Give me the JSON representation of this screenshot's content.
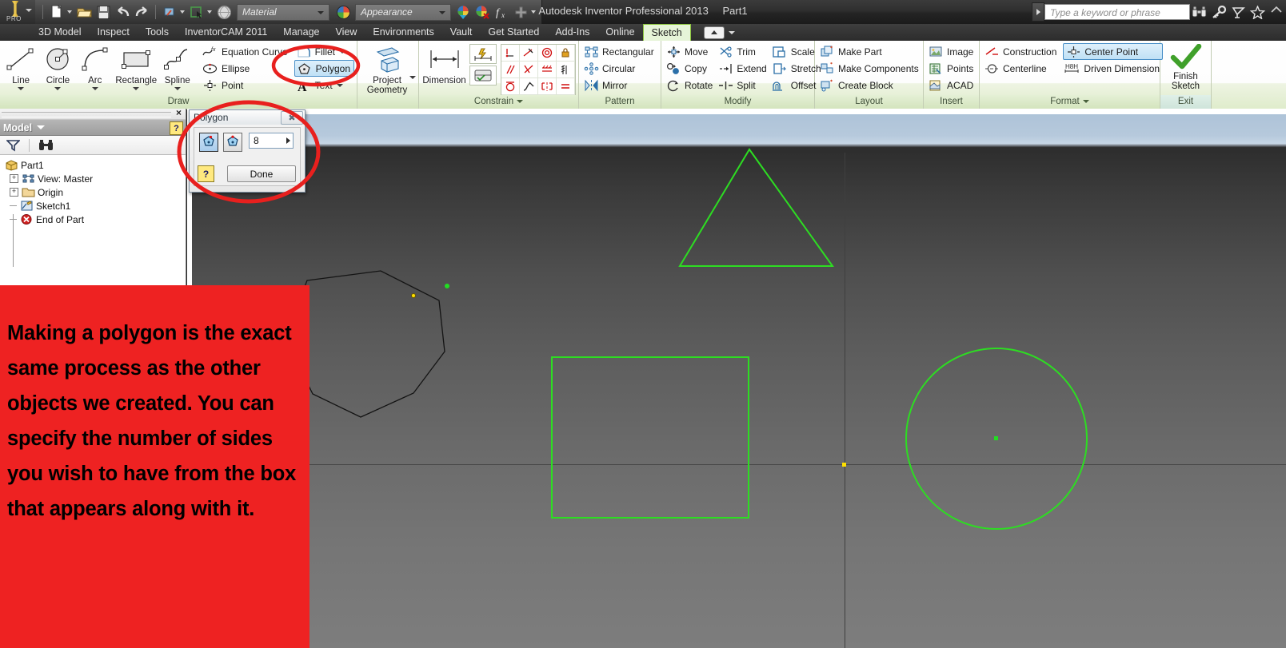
{
  "titlebar": {
    "app_title": "Autodesk Inventor Professional 2013",
    "document_name": "Part1",
    "logo_text": "PRO",
    "material_value": "Material",
    "appearance_value": "Appearance",
    "search_placeholder": "Type a keyword or phrase",
    "quick_access_icons": [
      "new-file-icon",
      "open-folder-icon",
      "save-icon",
      "undo-icon",
      "redo-icon",
      "update-icon",
      "select-icon",
      "material-sphere-icon"
    ],
    "help_icons": [
      "binoculars-icon",
      "key-icon",
      "satellite-icon",
      "star-icon"
    ]
  },
  "tabs": {
    "items": [
      "3D Model",
      "Inspect",
      "Tools",
      "InventorCAM 2011",
      "Manage",
      "View",
      "Environments",
      "Vault",
      "Get Started",
      "Add-Ins",
      "Online",
      "Sketch"
    ],
    "active": "Sketch"
  },
  "ribbon": {
    "panels": [
      {
        "title": "Draw",
        "has_dropdown": false,
        "big_buttons": [
          {
            "label": "Line",
            "icon": "line-tool-icon",
            "dropdown": true
          },
          {
            "label": "Circle",
            "icon": "circle-tool-icon",
            "dropdown": true
          },
          {
            "label": "Arc",
            "icon": "arc-tool-icon",
            "dropdown": true
          },
          {
            "label": "Rectangle",
            "icon": "rectangle-tool-icon",
            "dropdown": true
          },
          {
            "label": "Spline",
            "icon": "spline-tool-icon",
            "dropdown": true
          }
        ],
        "small_col_a": [
          {
            "label": "Equation Curve",
            "icon": "equation-curve-icon"
          },
          {
            "label": "Ellipse",
            "icon": "ellipse-icon"
          },
          {
            "label": "Point",
            "icon": "point-icon"
          }
        ],
        "small_col_b": [
          {
            "label": "Fillet",
            "icon": "fillet-icon",
            "dropdown": true,
            "selected": false
          },
          {
            "label": "Polygon",
            "icon": "polygon-icon",
            "dropdown": false,
            "selected": true
          },
          {
            "label": "Text",
            "icon": "text-icon",
            "dropdown": true,
            "selected": false
          }
        ]
      },
      {
        "title": "",
        "big_buttons": [
          {
            "label": "Project\nGeometry",
            "icon": "project-geometry-icon",
            "dropdown": true
          }
        ]
      },
      {
        "title": "Constrain",
        "has_dropdown": true,
        "big_buttons": [
          {
            "label": "Dimension",
            "icon": "dimension-icon",
            "dropdown": false
          }
        ],
        "stack_icons": [
          "auto-dimension-icon",
          "show-constraints-icon"
        ],
        "grid_icons": [
          "coincident-icon",
          "collinear-icon",
          "concentric-icon",
          "fix-icon",
          "parallel-icon",
          "perpendicular-icon",
          "horizontal-icon",
          "vertical-icon",
          "tangent-icon",
          "smooth-icon",
          "symmetric-icon",
          "equal-icon"
        ]
      },
      {
        "title": "Pattern",
        "small_col_a": [
          {
            "label": "Rectangular",
            "icon": "rectangular-pattern-icon"
          },
          {
            "label": "Circular",
            "icon": "circular-pattern-icon"
          },
          {
            "label": "Mirror",
            "icon": "mirror-icon"
          }
        ]
      },
      {
        "title": "Modify",
        "small_col_a": [
          {
            "label": "Move",
            "icon": "move-icon"
          },
          {
            "label": "Copy",
            "icon": "copy-icon"
          },
          {
            "label": "Rotate",
            "icon": "rotate-icon"
          }
        ],
        "small_col_b": [
          {
            "label": "Trim",
            "icon": "trim-icon"
          },
          {
            "label": "Extend",
            "icon": "extend-icon"
          },
          {
            "label": "Split",
            "icon": "split-icon"
          }
        ],
        "small_col_c": [
          {
            "label": "Scale",
            "icon": "scale-icon"
          },
          {
            "label": "Stretch",
            "icon": "stretch-icon"
          },
          {
            "label": "Offset",
            "icon": "offset-icon"
          }
        ]
      },
      {
        "title": "Layout",
        "small_col_a": [
          {
            "label": "Make Part",
            "icon": "make-part-icon"
          },
          {
            "label": "Make Components",
            "icon": "make-components-icon"
          },
          {
            "label": "Create Block",
            "icon": "create-block-icon"
          }
        ]
      },
      {
        "title": "Insert",
        "small_col_a": [
          {
            "label": "Image",
            "icon": "image-icon"
          },
          {
            "label": "Points",
            "icon": "points-excel-icon"
          },
          {
            "label": "ACAD",
            "icon": "acad-icon"
          }
        ]
      },
      {
        "title": "Format",
        "has_dropdown": true,
        "small_col_a": [
          {
            "label": "Construction",
            "icon": "construction-icon"
          },
          {
            "label": "Centerline",
            "icon": "centerline-icon"
          }
        ],
        "small_col_b": [
          {
            "label": "Center Point",
            "icon": "center-point-icon",
            "selected": true
          },
          {
            "label": "Driven Dimension",
            "icon": "driven-dimension-icon",
            "selected": false
          }
        ]
      },
      {
        "title": "Exit",
        "finish": {
          "label_line1": "Finish",
          "label_line2": "Sketch",
          "icon": "green-check-icon"
        }
      }
    ]
  },
  "browser": {
    "panel_title": "Model",
    "close_label": "×",
    "help_label": "?",
    "tool_icons": [
      "filter-icon",
      "find-binoculars-icon"
    ],
    "tree": [
      {
        "label": "Part1",
        "icon": "part-cube-icon",
        "expander": "",
        "level": 0
      },
      {
        "label": "View: Master",
        "icon": "view-master-icon",
        "expander": "+",
        "level": 1
      },
      {
        "label": "Origin",
        "icon": "folder-icon",
        "expander": "+",
        "level": 1
      },
      {
        "label": "Sketch1",
        "icon": "sketch-icon",
        "expander": "",
        "level": 1
      },
      {
        "label": "End of Part",
        "icon": "end-of-part-icon",
        "expander": "",
        "level": 1
      }
    ]
  },
  "polygon_dialog": {
    "title": "Polygon",
    "close_label": "✖",
    "inscribed_icon": "polygon-inscribed-icon",
    "circumscribed_icon": "polygon-circumscribed-icon",
    "sides_value": "8",
    "help_label": "?",
    "done_label": "Done"
  },
  "callout": {
    "text": "Making a polygon is the exact same process as the other objects we created. You can specify the number of sides you wish to have from the box that appears along with it.",
    "background_color": "#ee2222",
    "text_color": "#000000"
  },
  "canvas": {
    "sketch_color": "#22dd22",
    "active_polygon_color": "#111111",
    "origin_point_color": "#ffe000",
    "shapes": [
      {
        "name": "polygon-preview",
        "type": "polygon",
        "sides": 8,
        "color": "#111111"
      },
      {
        "name": "triangle",
        "type": "polygon",
        "sides": 3,
        "color": "#22dd22"
      },
      {
        "name": "rectangle",
        "type": "rectangle",
        "color": "#22dd22"
      },
      {
        "name": "circle",
        "type": "circle",
        "color": "#22dd22"
      }
    ]
  }
}
